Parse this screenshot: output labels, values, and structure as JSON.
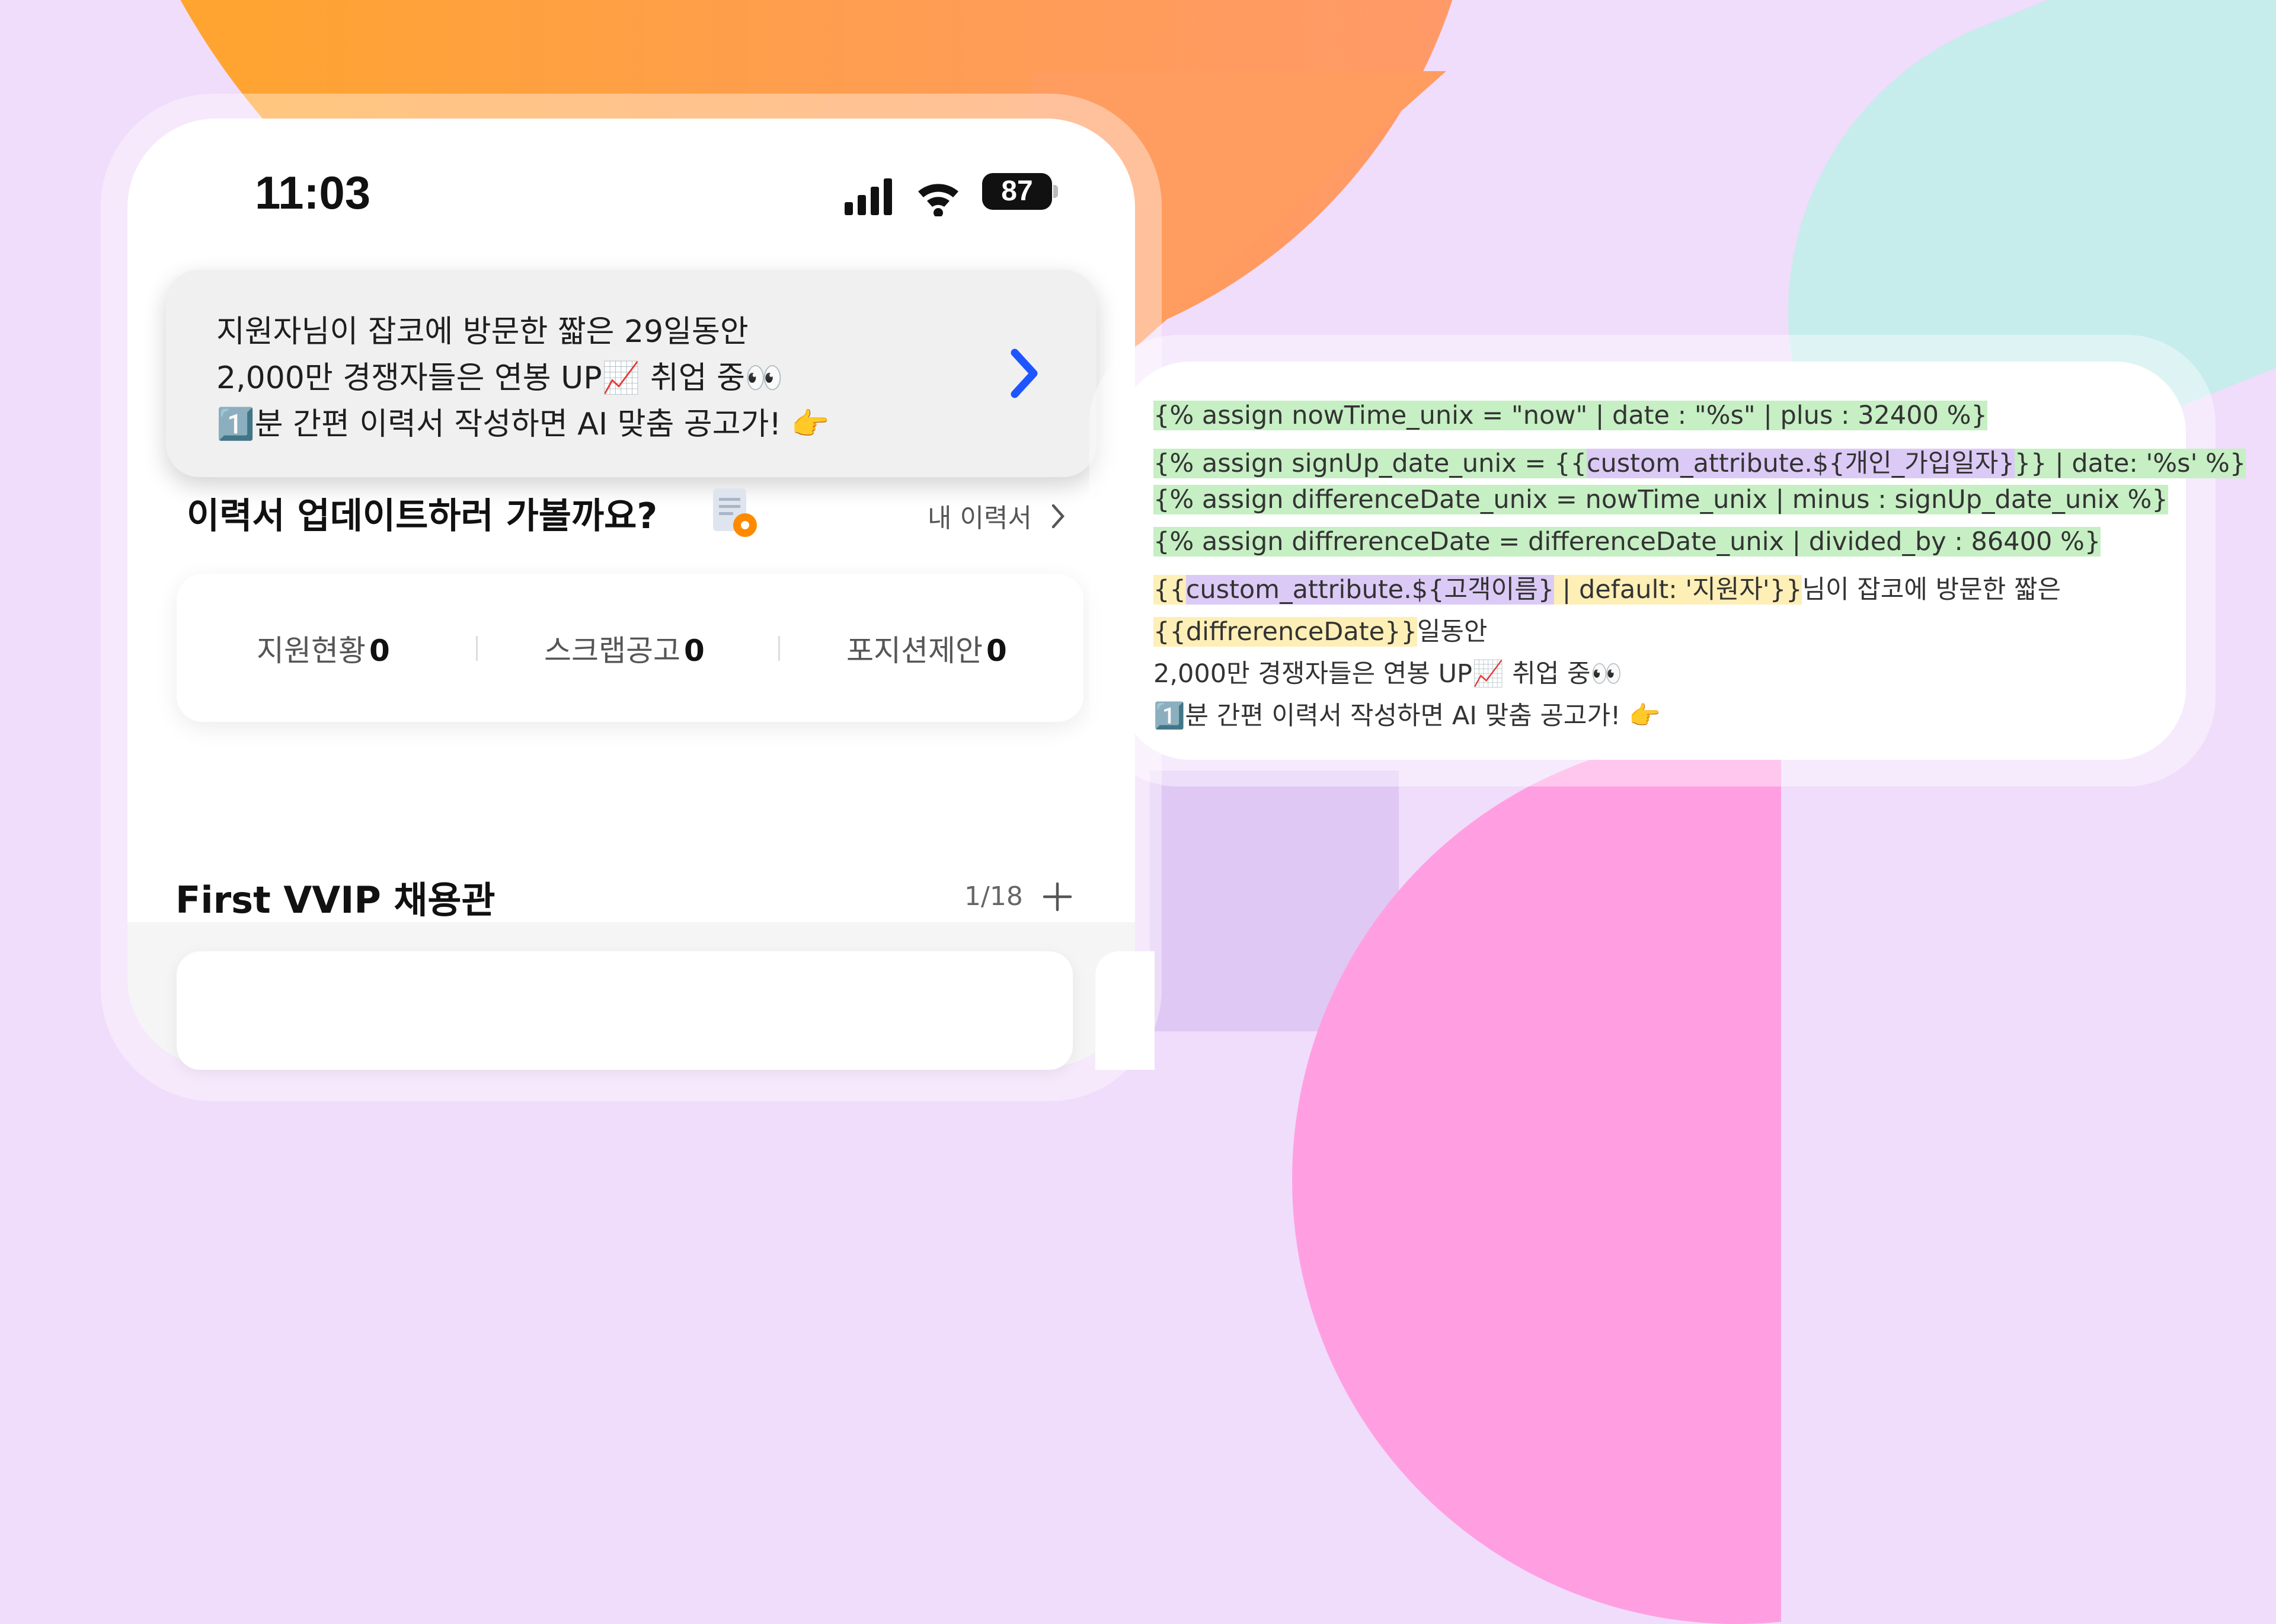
{
  "status_bar": {
    "time": "11:03",
    "battery": "87"
  },
  "notification": {
    "line1": "지원자님이 잡코에 방문한 짧은 29일동안",
    "line2": "2,000만 경쟁자들은 연봉 UP📈 취업 중👀",
    "line3": "1️⃣분 간편 이력서 작성하면 AI 맞춤 공고가! 👉"
  },
  "resume_section": {
    "title": "이력서 업데이트하러 가볼까요?",
    "link": "내 이력서",
    "stats": [
      {
        "label": "지원현황",
        "value": "0"
      },
      {
        "label": "스크랩공고",
        "value": "0"
      },
      {
        "label": "포지션제안",
        "value": "0"
      }
    ]
  },
  "vvip_section": {
    "title": "First VVIP 채용관",
    "count": "1/18"
  },
  "code": {
    "l1": "{% assign nowTime_unix = \"now\" | date : \"%s\" | plus : 32400 %}",
    "l2a": "{% assign signUp_date_unix = {{",
    "l2b": "custom_attribute.${개인_가입일자}",
    "l2c": "}} | date: '%s' %}",
    "l3": "{% assign differenceDate_unix = nowTime_unix | minus : signUp_date_unix %}",
    "l4": "{% assign diffrerenceDate = differenceDate_unix | divided_by : 86400 %}",
    "l5a": "{{",
    "l5b": "custom_attribute.${고객이름}",
    "l5c": " | default: '지원자'}}",
    "l5d": "님이 잡코에 방문한 짧은",
    "l6a": "{{diffrerenceDate}}",
    "l6b": "일동안",
    "l7": "2,000만 경쟁자들은 연봉 UP📈 취업 중👀",
    "l8": "1️⃣분 간편 이력서 작성하면 AI 맞춤 공고가! 👉"
  },
  "colors": {
    "accent_blue": "#1f55ff",
    "highlight_green": "#c6efc4",
    "highlight_purple": "#dccaf6",
    "highlight_yellow": "#fdefb6",
    "orange_icon": "#ff8a00"
  }
}
